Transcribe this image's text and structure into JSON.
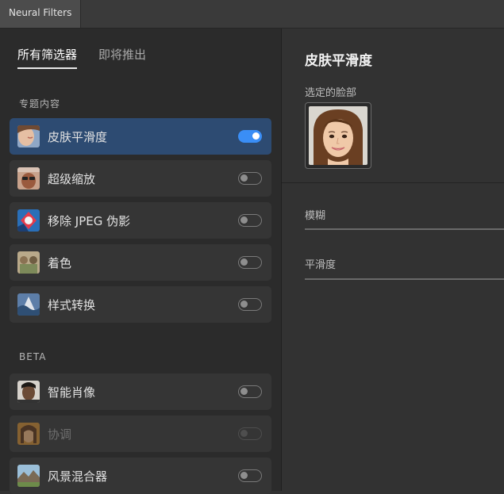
{
  "window": {
    "tab_title": "Neural Filters"
  },
  "filter_tabs": [
    {
      "label": "所有筛选器",
      "active": true
    },
    {
      "label": "即将推出",
      "active": false
    }
  ],
  "sections": {
    "featured": {
      "label": "专题内容",
      "items": [
        {
          "label": "皮肤平滑度",
          "icon": "skin-smoothing-thumbnail",
          "enabled": true,
          "selected": true
        },
        {
          "label": "超级缩放",
          "icon": "super-zoom-thumbnail",
          "enabled": false,
          "selected": false
        },
        {
          "label": "移除 JPEG 伪影",
          "icon": "jpeg-artifact-removal-thumbnail",
          "enabled": false,
          "selected": false
        },
        {
          "label": "着色",
          "icon": "colorize-thumbnail",
          "enabled": false,
          "selected": false
        },
        {
          "label": "样式转换",
          "icon": "style-transfer-thumbnail",
          "enabled": false,
          "selected": false
        }
      ]
    },
    "beta": {
      "label": "BETA",
      "items": [
        {
          "label": "智能肖像",
          "icon": "smart-portrait-thumbnail",
          "enabled": false,
          "selected": false,
          "disabled": false
        },
        {
          "label": "协调",
          "icon": "harmonization-thumbnail",
          "enabled": false,
          "selected": false,
          "disabled": true
        },
        {
          "label": "风景混合器",
          "icon": "landscape-mixer-thumbnail",
          "enabled": false,
          "selected": false,
          "disabled": false
        }
      ]
    }
  },
  "detail": {
    "title": "皮肤平滑度",
    "selected_face_label": "选定的脸部",
    "sliders": [
      {
        "label": "模糊"
      },
      {
        "label": "平滑度"
      }
    ]
  },
  "colors": {
    "accent": "#3a8ef6",
    "selected_row": "#2d4b72",
    "panel_bg": "#2b2b2b"
  }
}
